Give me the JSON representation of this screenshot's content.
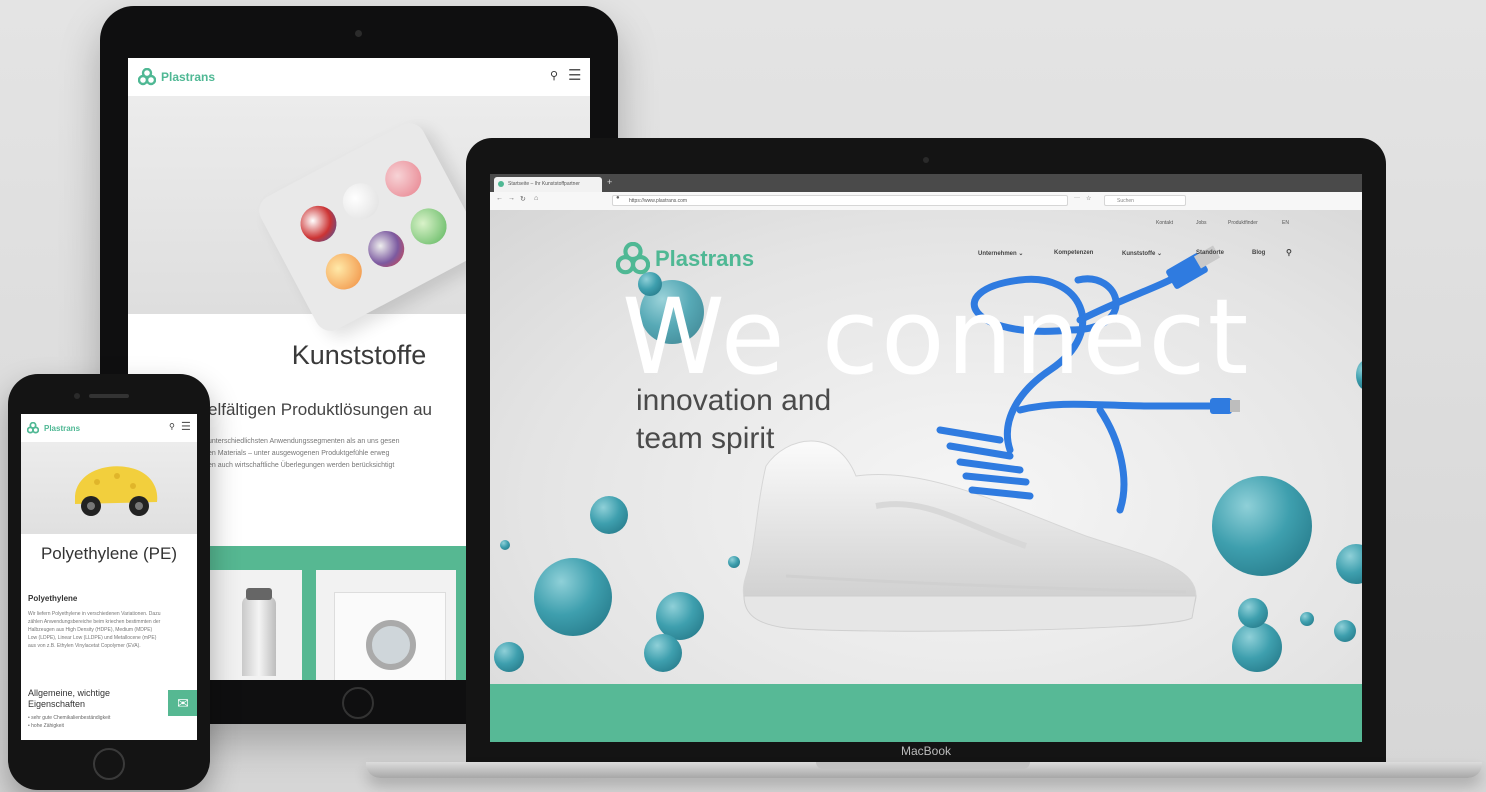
{
  "colors": {
    "accent": "#56b892",
    "text": "#3a3a3a",
    "bubble": "#3e9fae",
    "cable": "#2f7be0"
  },
  "tablet": {
    "brand": "Plastrans",
    "title": "Kunststoffe",
    "subtitle": "elfältigen Produktlösungen au",
    "body": [
      "unterschiedlichsten Anwendungssegmenten als an uns gesen",
      "en Materials – unter ausgewogenen Produktgefühle erweg",
      "en auch wirtschaftliche Überlegungen werden berücksichtigt"
    ],
    "icons": [
      "search-icon",
      "menu-icon"
    ]
  },
  "phone": {
    "brand": "Plastrans",
    "title": "Polyethylene (PE)",
    "heading": "Polyethylene",
    "body": [
      "Wir liefern Polyethylene in verschiedenen Variationen. Dazu",
      "zählen Anwendungsbereiche beim kriechen bestimmten der",
      "Halbzeugen aus High Density (HDPE), Medium (MDPE)",
      "Low (LDPE), Linear Low (LLDPE) und Metallocene (mPE)",
      "aus von z.B. Ethylen Vinylacetat Copolymer (EVA)."
    ],
    "heading2": "Allgemeine, wichtige Eigenschaften",
    "list": [
      "• sehr gute Chemikalienbeständigkeit",
      "• hohe Zähigkeit"
    ],
    "icons": [
      "search-icon",
      "menu-icon",
      "mail-icon"
    ]
  },
  "laptop": {
    "brand_label": "MacBook",
    "browser": {
      "tab_title": "Startseite – Ihr Kunststoffpartner",
      "url": "https://www.plastrans.com",
      "search_placeholder": "Suchen"
    },
    "site": {
      "brand": "Plastrans",
      "utility_links": [
        "Kontakt",
        "Jobs",
        "Produktfinder",
        "EN"
      ],
      "nav": [
        "Unternehmen ⌄",
        "Kompetenzen",
        "Kunststoffe ⌄",
        "Standorte",
        "Blog"
      ],
      "hero_title": "We connect",
      "hero_tagline": [
        "innovation and",
        "team spirit"
      ]
    }
  }
}
